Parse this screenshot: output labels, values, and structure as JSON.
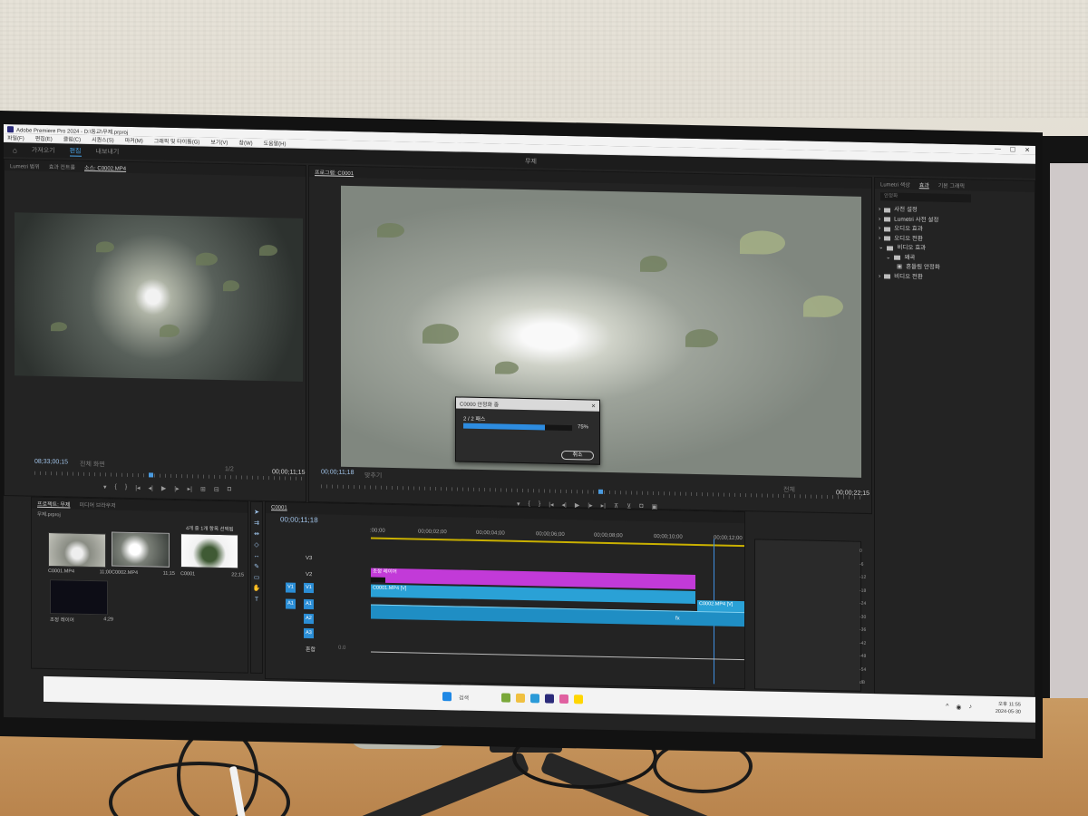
{
  "window": {
    "title": "Adobe Premiere Pro 2024 - D:\\동교\\무제.prproj",
    "controls": [
      "—",
      "☐",
      "✕"
    ]
  },
  "menu": [
    "파일(F)",
    "편집(E)",
    "클립(C)",
    "시퀀스(S)",
    "마커(M)",
    "그래픽 및 타이틀(G)",
    "보기(V)",
    "창(W)",
    "도움말(H)"
  ],
  "workspace": {
    "tabs": [
      "가져오기",
      "편집",
      "내보내기"
    ],
    "active": "편집",
    "center": "무제"
  },
  "source_panel": {
    "tabs": [
      "Lumetri 범위",
      "효과 컨트롤",
      "소스: C0002.MP4"
    ],
    "timecode_left": "08;33;00;15",
    "fit_label": "전체 화면",
    "fraction": "1/2",
    "timecode_right": "00;00;11;15"
  },
  "program_panel": {
    "tab": "프로그램: C0001",
    "timecode_left": "00;00;11;18",
    "fit_label": "맞추기",
    "fraction": "전체",
    "timecode_right": "00;00;22;15"
  },
  "dialog": {
    "title": "C0000 안정화 중",
    "pass_text": "2 / 2 패스",
    "progress": 75,
    "progress_label": "75%",
    "cancel_label": "취소"
  },
  "effects_panel": {
    "tabs": [
      "Lumetri 색상",
      "효과",
      "기본 그래픽"
    ],
    "search_placeholder": "안정화",
    "items": [
      {
        "label": "사전 설정",
        "indent": 0
      },
      {
        "label": "Lumetri 사전 설정",
        "indent": 0
      },
      {
        "label": "오디오 효과",
        "indent": 0
      },
      {
        "label": "오디오 전환",
        "indent": 0
      },
      {
        "label": "비디오 효과",
        "indent": 0
      },
      {
        "label": "왜곡",
        "indent": 1
      },
      {
        "label": "흔들림 안정화",
        "indent": 2
      },
      {
        "label": "비디오 전환",
        "indent": 0
      }
    ]
  },
  "project_panel": {
    "tabs": [
      "프로젝트: 무제",
      "미디어 브라우저"
    ],
    "file": "무제.prproj",
    "selection_info": "4개 중 1개 항목 선택됨",
    "items": [
      {
        "name": "C0001.MP4",
        "duration": "11;00"
      },
      {
        "name": "C0002.MP4",
        "duration": "11;15"
      },
      {
        "name": "C0001",
        "duration": "22;15"
      },
      {
        "name": "조정 레이어",
        "duration": "4;29"
      }
    ]
  },
  "timeline": {
    "tab": "C0001",
    "timecode": "00;00;11;18",
    "ruler": [
      ":00;00",
      "00;00;02;00",
      "00;00;04;00",
      "00;00;06;00",
      "00;00;08;00",
      "00;00;10;00",
      "00;00;12;00"
    ],
    "tracks": [
      "V3",
      "V2",
      "V1",
      "A1",
      "A2",
      "A3"
    ],
    "mix_label": "혼합",
    "mix_value": "0.0",
    "clips": {
      "adjust": "조정 레이어",
      "v1_a": "C0001.MP4 [V]",
      "v1_b": "C0002.MP4 [V]",
      "fx_badge": "fx"
    }
  },
  "audio_meter": {
    "scale": [
      "0",
      "-6",
      "-12",
      "-18",
      "-24",
      "-30",
      "-36",
      "-42",
      "-48",
      "-54",
      "dB"
    ]
  },
  "taskbar": {
    "search": "검색",
    "time": "오후 11:55",
    "date": "2024-05-30"
  }
}
